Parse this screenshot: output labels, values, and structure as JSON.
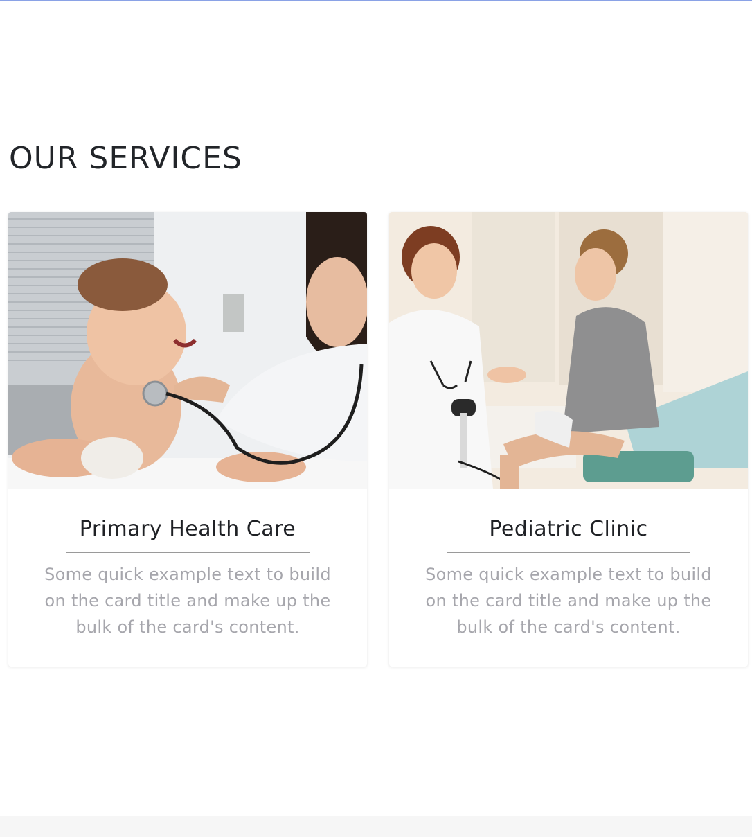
{
  "section": {
    "title": "OUR SERVICES"
  },
  "cards": [
    {
      "image_alt": "doctor-with-baby-photo",
      "title": "Primary Health Care",
      "text": "Some quick example text to build on the card title and make up the bulk of the card's content."
    },
    {
      "image_alt": "doctor-with-patient-photo",
      "title": "Pediatric Clinic",
      "text": "Some quick example text to build on the card title and make up the bulk of the card's content."
    }
  ],
  "colors": {
    "top_line": "#8aa2e6",
    "title": "#222529",
    "card_text": "#a6a6ac",
    "footer_band": "#f6f6f6"
  }
}
